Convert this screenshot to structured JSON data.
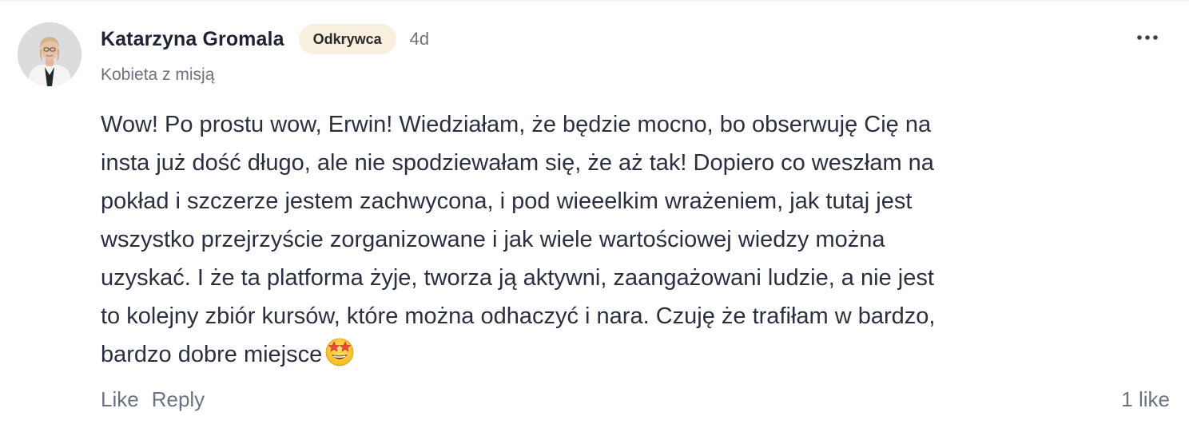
{
  "comment": {
    "author": {
      "name": "Katarzyna Gromala",
      "badge": "Odkrywca",
      "subtitle": "Kobieta z misją",
      "avatar": "profile-photo"
    },
    "timestamp": "4d",
    "menu_icon": "more-horizontal-icon",
    "body": "Wow! Po prostu wow, Erwin! Wiedziałam, że będzie mocno, bo obserwuję Cię na\ninsta już dość długo, ale nie spodziewałam się, że aż tak! Dopiero co weszłam na\npokład i szczerze jestem zachwycona, i pod wieeelkim wrażeniem, jak tutaj jest\nwszystko przejrzyście zorganizowane i jak wiele wartościowej wiedzy można\nuzyskać. I że ta platforma żyje, tworza ją aktywni, zaangażowani ludzie, a nie jest\nto kolejny zbiór kursów, które można odhaczyć i nara. Czuję że trafiłam w bardzo,\nbardzo dobre miejsce",
    "emoji": "star-struck-emoji",
    "actions": {
      "like": "Like",
      "reply": "Reply"
    },
    "likes_count": "1 like"
  },
  "colors": {
    "badge_background": "#f8efdf",
    "text_primary": "#2b3040",
    "text_muted": "#6d7280"
  }
}
